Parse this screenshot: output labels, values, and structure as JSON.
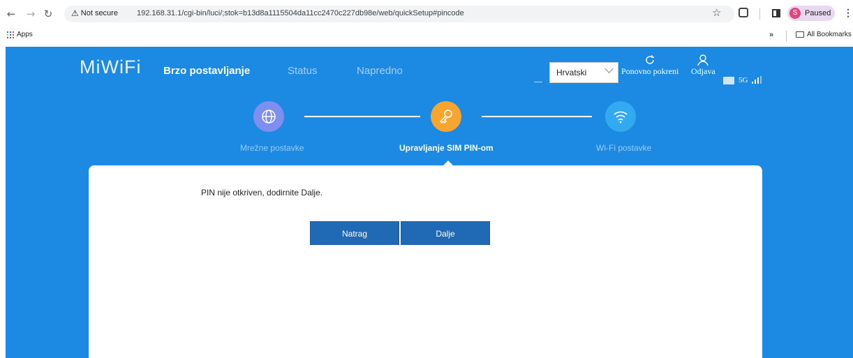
{
  "browser": {
    "security_label": "Not secure",
    "url": "192.168.31.1/cgi-bin/luci/;stok=b13d8a1115504da11cc2470c227db98e/web/quickSetup#pincode",
    "profile_initial": "S",
    "profile_label": "Paused",
    "bookmarks": {
      "apps_label": "Apps",
      "all_bookmarks_label": "All Bookmarks"
    }
  },
  "router": {
    "logo": "MiWiFi",
    "nav": [
      "Brzo postavljanje",
      "Status",
      "Napredno"
    ],
    "language": "Hrvatski",
    "restart_label": "Ponovno pokreni",
    "logout_label": "Odjava",
    "band_label": "5G"
  },
  "steps": [
    {
      "label": "Mrežne postavke",
      "icon": "globe-icon",
      "color": "#7f8ff0"
    },
    {
      "label": "Upravljanje SIM PIN-om",
      "icon": "key-icon",
      "color": "#f7a52e"
    },
    {
      "label": "Wi-Fi postavke",
      "icon": "wifi-icon",
      "color": "#33a9f0"
    }
  ],
  "content": {
    "message": "PIN nije otkriven, dodirnite Dalje.",
    "back_label": "Natrag",
    "next_label": "Dalje"
  },
  "colors": {
    "header_bg": "#1c8ae3",
    "button_bg": "#2069b4"
  }
}
